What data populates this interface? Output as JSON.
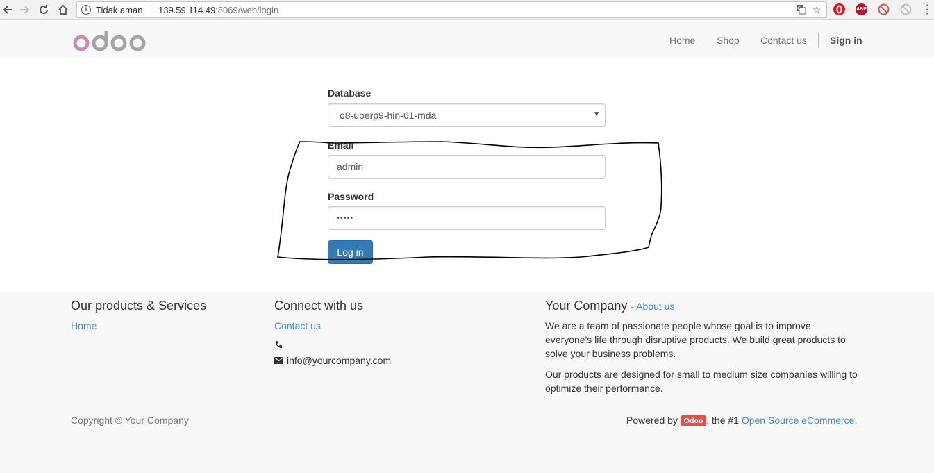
{
  "browser": {
    "security_label": "Tidak aman",
    "url_host": "139.59.114.49",
    "url_rest": ":8069/web/login",
    "icons": [
      "back-icon",
      "forward-icon",
      "reload-icon",
      "home-icon",
      "info-icon",
      "translate-icon",
      "bookmark-star-icon",
      "opera-icon",
      "adblock-icon",
      "extension-icon",
      "extension-icon",
      "menu-icon"
    ],
    "abp_label": "ABP"
  },
  "navbar": {
    "logo_text": "odoo",
    "links": [
      "Home",
      "Shop",
      "Contact us"
    ],
    "sign_in": "Sign in"
  },
  "login": {
    "database_label": "Database",
    "database_value": "o8-uperp9-hin-61-mda",
    "email_label": "Email",
    "email_value": "admin",
    "password_label": "Password",
    "password_value": "•••••",
    "login_button": "Log in"
  },
  "footer": {
    "products_heading": "Our products & Services",
    "products_link": "Home",
    "connect_heading": "Connect with us",
    "connect_link": "Contact us",
    "email": "info@yourcompany.com",
    "company_heading": "Your Company",
    "about_link": "- About us",
    "paragraph1": "We are a team of passionate people whose goal is to improve everyone's life through disruptive products. We build great products to solve your business problems.",
    "paragraph2": "Our products are designed for small to medium size companies willing to optimize their performance.",
    "copyright": "Copyright © Your Company",
    "powered_prefix": "Powered by",
    "powered_badge": "Odoo",
    "powered_mid": ", the #1",
    "powered_link": "Open Source eCommerce",
    "powered_suffix": "."
  },
  "colors": {
    "primary": "#337ab7",
    "link": "#428bca",
    "badge": "#d9534f",
    "logo_purple": "#c98bb9",
    "logo_grey": "#a4a4a4"
  }
}
